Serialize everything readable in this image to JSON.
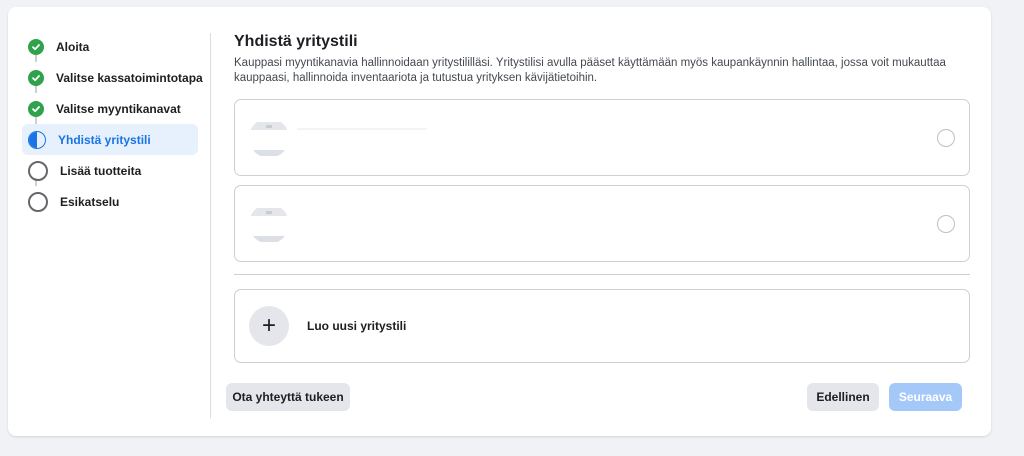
{
  "sidebar": {
    "steps": [
      {
        "label": "Aloita",
        "status": "complete",
        "icon": "check-circle-icon"
      },
      {
        "label": "Valitse kassatoimintotapa",
        "status": "complete",
        "icon": "check-circle-icon"
      },
      {
        "label": "Valitse myyntikanavat",
        "status": "complete",
        "icon": "check-circle-icon"
      },
      {
        "label": "Yhdistä yritystili",
        "status": "active",
        "icon": "half-circle-icon"
      },
      {
        "label": "Lisää tuotteita",
        "status": "pending",
        "icon": "empty-circle-icon"
      },
      {
        "label": "Esikatselu",
        "status": "pending",
        "icon": "empty-circle-icon"
      }
    ]
  },
  "main": {
    "title": "Yhdistä yritystili",
    "description": "Kauppasi myyntikanavia hallinnoidaan yritystililläsi. Yritystilisi avulla pääset käyttämään myös kaupankäynnin hallintaa, jossa voit mukauttaa kauppaasi, hallinnoida inventaariota ja tutustua yrityksen kävijätietoihin.",
    "accounts": [
      {
        "selected": false,
        "icon": "briefcase-icon"
      },
      {
        "selected": false,
        "icon": "briefcase-icon"
      }
    ],
    "create_label": "Luo uusi yritystili",
    "create_icon": "plus-icon"
  },
  "footer": {
    "support_label": "Ota yhteyttä tukeen",
    "previous_label": "Edellinen",
    "next_label": "Seuraava"
  },
  "colors": {
    "accent": "#1b74e4",
    "success": "#31a24c",
    "disabled_primary": "#a4c9f8"
  }
}
